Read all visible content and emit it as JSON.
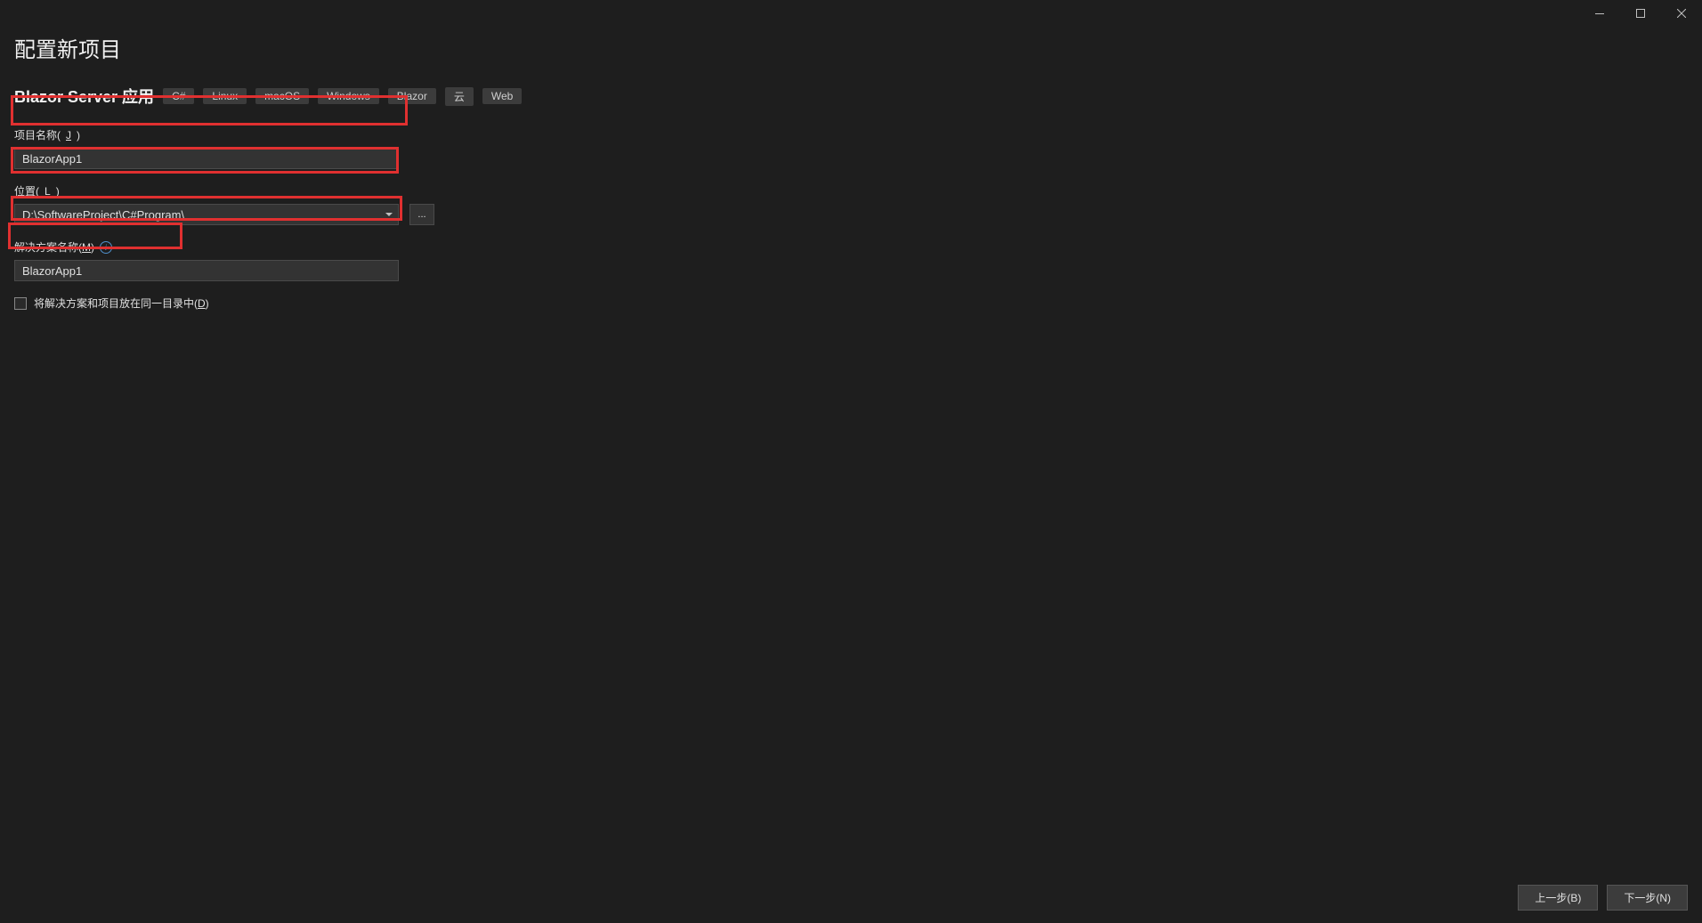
{
  "window": {
    "min_tooltip": "最小化",
    "max_tooltip": "最大化",
    "close_tooltip": "关闭"
  },
  "page": {
    "title": "配置新项目",
    "template_name": "Blazor Server 应用",
    "tags": [
      "C#",
      "Linux",
      "macOS",
      "Windows",
      "Blazor",
      "云",
      "Web"
    ]
  },
  "fields": {
    "project_name": {
      "label_prefix": "项目名称(",
      "label_suffix": ")",
      "hotkey": "J",
      "value": "BlazorApp1"
    },
    "location": {
      "label_prefix": "位置(",
      "label_suffix": ")",
      "hotkey": "L",
      "value": "D:\\SoftwareProject\\C#Program\\",
      "browse": "..."
    },
    "solution_name": {
      "label_prefix": "解决方案名称(",
      "label_suffix": ")",
      "hotkey": "M",
      "value": "BlazorApp1",
      "info": "i"
    },
    "same_dir": {
      "label_prefix": "将解决方案和项目放在同一目录中(",
      "label_suffix": ")",
      "hotkey": "D",
      "checked": false
    }
  },
  "footer": {
    "back": "上一步(B)",
    "next": "下一步(N)"
  }
}
